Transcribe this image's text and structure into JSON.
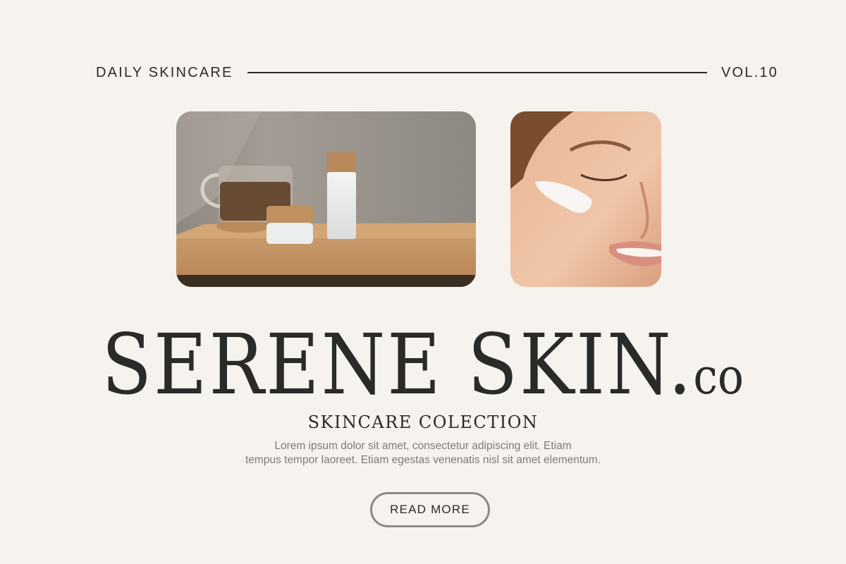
{
  "header": {
    "left_label": "DAILY SKINCARE",
    "right_label": "VOL.10"
  },
  "images": {
    "products": {
      "icon": "skincare-products-photo"
    },
    "face": {
      "icon": "face-cream-photo"
    }
  },
  "brand": {
    "name": "SERENE SKIN",
    "dot": ".",
    "suffix": "co"
  },
  "subtitle": "SKINCARE COLECTION",
  "description": {
    "line1": "Lorem ipsum dolor sit amet, consectetur adipiscing elit. Etiam",
    "line2": "tempus tempor laoreet. Etiam egestas venenatis nisl sit amet elementum."
  },
  "cta": {
    "label": "READ MORE"
  },
  "colors": {
    "background": "#f6f3ef",
    "text": "#2b2a28",
    "muted_text": "#7d7b78",
    "button_border": "#8c8a87"
  }
}
